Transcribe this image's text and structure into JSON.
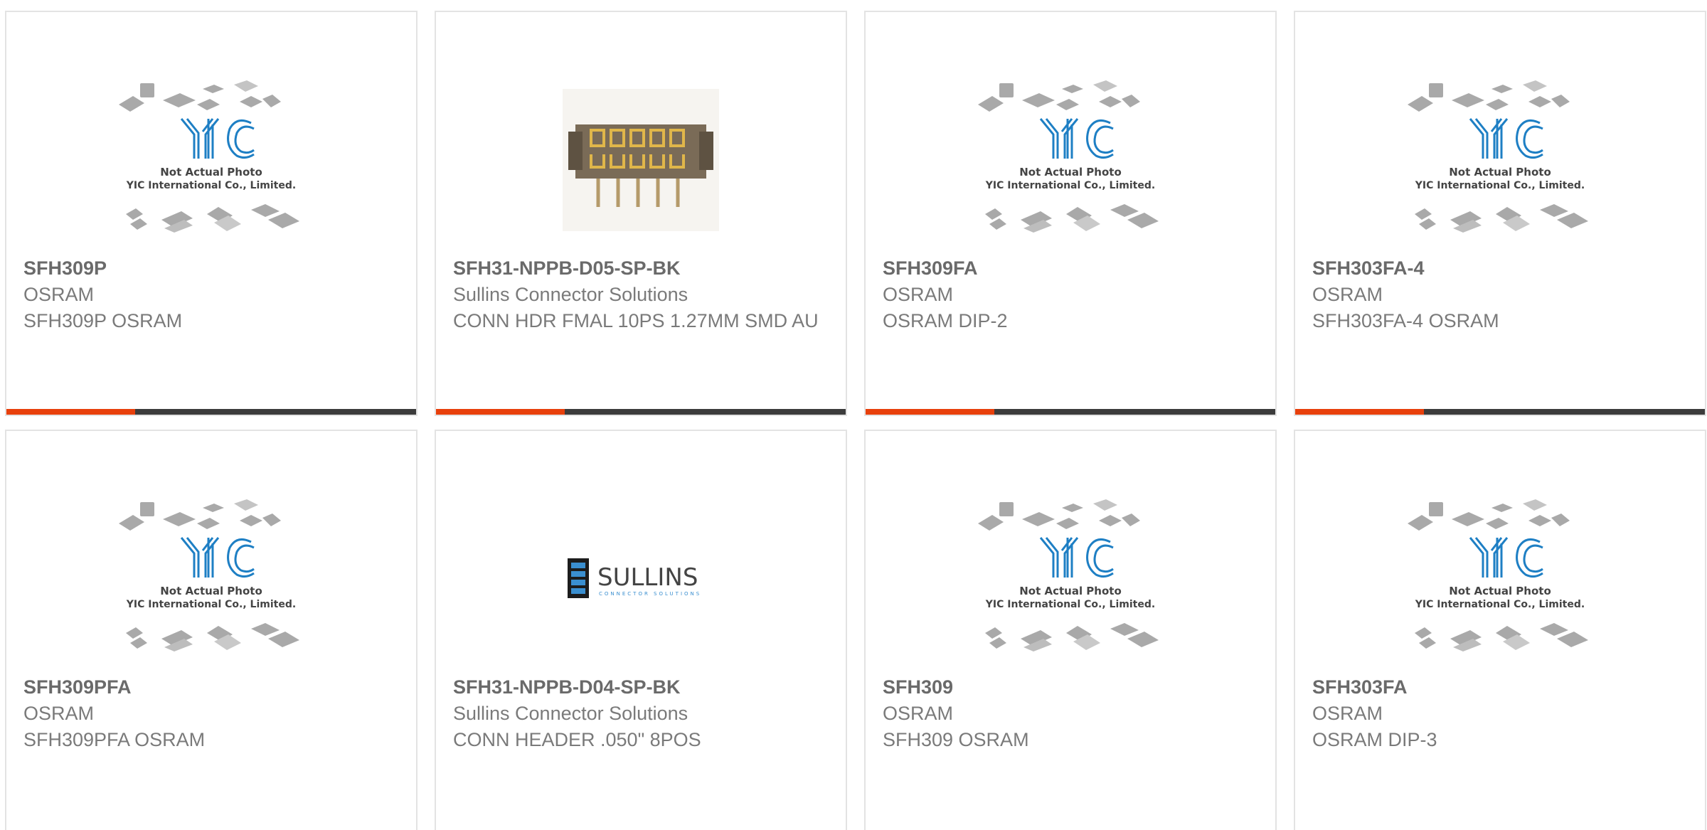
{
  "theme": {
    "accent": "#e8400c",
    "bar_dark": "#3c3c3c",
    "yic_blue": "#1e7fc4",
    "text_gray": "#7a7a7a"
  },
  "placeholder": {
    "line1": "Not Actual Photo",
    "line2": "YIC International Co., Limited.",
    "logo_text": "YIC"
  },
  "sullins_logo": {
    "name": "SULLINS",
    "tagline": "CONNECTOR SOLUTIONS"
  },
  "products": [
    {
      "part": "SFH309P",
      "manufacturer": "OSRAM",
      "description": "SFH309P OSRAM",
      "image": "yic-placeholder",
      "progress": 0.315
    },
    {
      "part": "SFH31-NPPB-D05-SP-BK",
      "manufacturer": "Sullins Connector Solutions",
      "description": "CONN HDR FMAL 10PS 1.27MM SMD AU",
      "image": "connector-photo",
      "progress": 0.315
    },
    {
      "part": "SFH309FA",
      "manufacturer": "OSRAM",
      "description": "OSRAM DIP-2",
      "image": "yic-placeholder",
      "progress": 0.315
    },
    {
      "part": "SFH303FA-4",
      "manufacturer": "OSRAM",
      "description": "SFH303FA-4 OSRAM",
      "image": "yic-placeholder",
      "progress": 0.315
    },
    {
      "part": "SFH309PFA",
      "manufacturer": "OSRAM",
      "description": "SFH309PFA OSRAM",
      "image": "yic-placeholder"
    },
    {
      "part": "SFH31-NPPB-D04-SP-BK",
      "manufacturer": "Sullins Connector Solutions",
      "description": "CONN HEADER .050\" 8POS",
      "image": "sullins-logo"
    },
    {
      "part": "SFH309",
      "manufacturer": "OSRAM",
      "description": "SFH309 OSRAM",
      "image": "yic-placeholder"
    },
    {
      "part": "SFH303FA",
      "manufacturer": "OSRAM",
      "description": "OSRAM DIP-3",
      "image": "yic-placeholder"
    }
  ]
}
